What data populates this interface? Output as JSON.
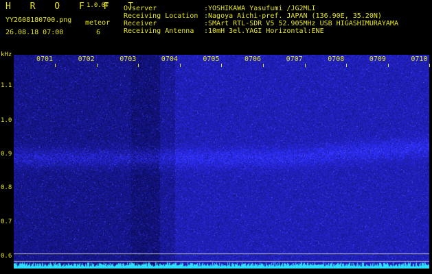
{
  "header": {
    "brand": "H R O F F T",
    "version": "1.0.0f",
    "filename": "YY2608180700.png",
    "timestamp": "26.08.18 07:00",
    "mode_label": "meteor",
    "meteor_count": "6"
  },
  "station": {
    "overviewer_label": "Ovserver",
    "overviewer_value": ":YOSHIKAWA Yasufumi /JG2MLI",
    "location_label": "Receiving Location",
    "location_value": ":Nagoya Aichi-pref. JAPAN (136.90E, 35.20N)",
    "receiver_label": "Receiver",
    "receiver_value": ":SMArt RTL-SDR V5 52.905MHz USB HIGASHIMURAYAMA",
    "antenna_label": "Receiving Antenna",
    "antenna_value": ":10mH 3el.YAGI Horizontal:ENE"
  },
  "axis": {
    "unit": "kHz",
    "yticks": [
      "1.1",
      "1.0",
      "0.9",
      "0.8",
      "0.7",
      "0.6"
    ],
    "xticks": [
      "0701",
      "0702",
      "0703",
      "0704",
      "0705",
      "0706",
      "0707",
      "0708",
      "0709",
      "0710"
    ]
  },
  "colors": {
    "text": "#e6e61e",
    "background": "#000000",
    "spectrum_base": "#0a0a4a",
    "spectrum_signal": "#2a2aff",
    "bottom_band": "#30e0ff"
  }
}
